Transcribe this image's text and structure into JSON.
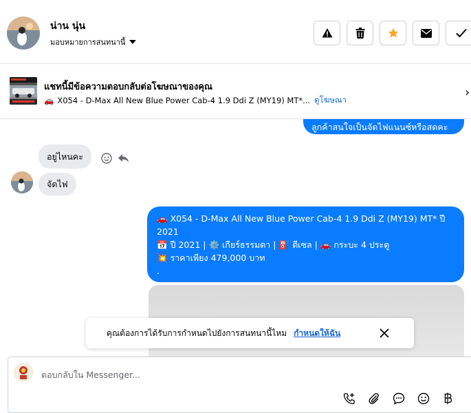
{
  "header": {
    "name": "น่าน นุ่น",
    "assign_label": "มอบหมายการสนทนานี้"
  },
  "ad": {
    "title": "แชทนี้มีข้อความตอบกลับต่อโฆษณาของคุณ",
    "subtitle_emoji": "🚗",
    "subtitle": "X054 - D-Max All New Blue Power Cab-4 1.9 Ddi Z (MY19) MT*...",
    "view_ad_link": "ดูโฆษณา"
  },
  "chat": {
    "outgoing_top": "ลูกค้าสนใจเป็นจัดไฟแนนซ์หรือสดคะ",
    "incoming_1": "อยู่ไหนคะ",
    "incoming_2": "จัดไฟ",
    "listing": {
      "line1_emoji": "🚗",
      "line1": "X054 - D-Max All New Blue Power Cab-4 1.9 Ddi Z (MY19) MT* ปี 2021",
      "line2_emoji1": "📅",
      "line2_part1": "ปี 2021 |",
      "line2_emoji2": "⚙️",
      "line2_part2": "เกียร์ธรรมดา |",
      "line2_emoji3": "⛽",
      "line2_part3": "ดีเซล |",
      "line2_emoji4": "🚗",
      "line2_part4": "กระบะ 4 ประตู",
      "line3_emoji": "💥",
      "line3": "ราคาเพียง 479,000 บาท",
      "line4": "."
    }
  },
  "prompt": {
    "text": "คุณต้องการได้รับการกำหนดไปยังการสนทนานี้ไหม",
    "link": "กำหนดให้ฉัน"
  },
  "composer": {
    "placeholder": "ตอบกลับใน Messenger..."
  },
  "colors": {
    "accent_blue": "#0a7cff",
    "link_blue": "#1a66d6",
    "star_orange": "#f5a623",
    "incoming_bg": "#e9eaee"
  },
  "icons": {
    "warning": "warning-icon",
    "trash": "trash-icon",
    "star": "star-icon",
    "mail": "mail-icon",
    "check": "check-icon",
    "emoji": "emoji-icon",
    "reply": "reply-icon",
    "close": "close-icon",
    "call_add": "call-add-icon",
    "attach": "attach-icon",
    "chat_bubble": "chat-bubble-icon",
    "smile": "smile-icon",
    "baht": "baht-icon",
    "chevron_right": "chevron-right-icon"
  }
}
